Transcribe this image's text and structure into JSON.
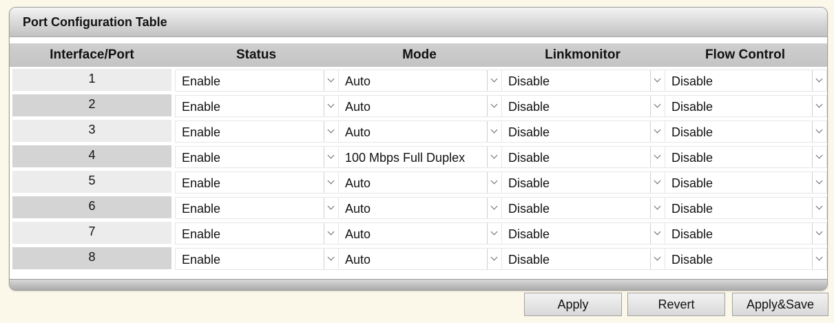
{
  "panel": {
    "title": "Port Configuration Table"
  },
  "columns": [
    "Interface/Port",
    "Status",
    "Mode",
    "Linkmonitor",
    "Flow Control"
  ],
  "rows": [
    {
      "port": "1",
      "status": "Enable",
      "mode": "Auto",
      "linkmonitor": "Disable",
      "flow_control": "Disable"
    },
    {
      "port": "2",
      "status": "Enable",
      "mode": "Auto",
      "linkmonitor": "Disable",
      "flow_control": "Disable"
    },
    {
      "port": "3",
      "status": "Enable",
      "mode": "Auto",
      "linkmonitor": "Disable",
      "flow_control": "Disable"
    },
    {
      "port": "4",
      "status": "Enable",
      "mode": "100 Mbps Full Duplex",
      "linkmonitor": "Disable",
      "flow_control": "Disable"
    },
    {
      "port": "5",
      "status": "Enable",
      "mode": "Auto",
      "linkmonitor": "Disable",
      "flow_control": "Disable"
    },
    {
      "port": "6",
      "status": "Enable",
      "mode": "Auto",
      "linkmonitor": "Disable",
      "flow_control": "Disable"
    },
    {
      "port": "7",
      "status": "Enable",
      "mode": "Auto",
      "linkmonitor": "Disable",
      "flow_control": "Disable"
    },
    {
      "port": "8",
      "status": "Enable",
      "mode": "Auto",
      "linkmonitor": "Disable",
      "flow_control": "Disable"
    }
  ],
  "buttons": {
    "apply": "Apply",
    "revert": "Revert",
    "apply_save": "Apply&Save"
  }
}
